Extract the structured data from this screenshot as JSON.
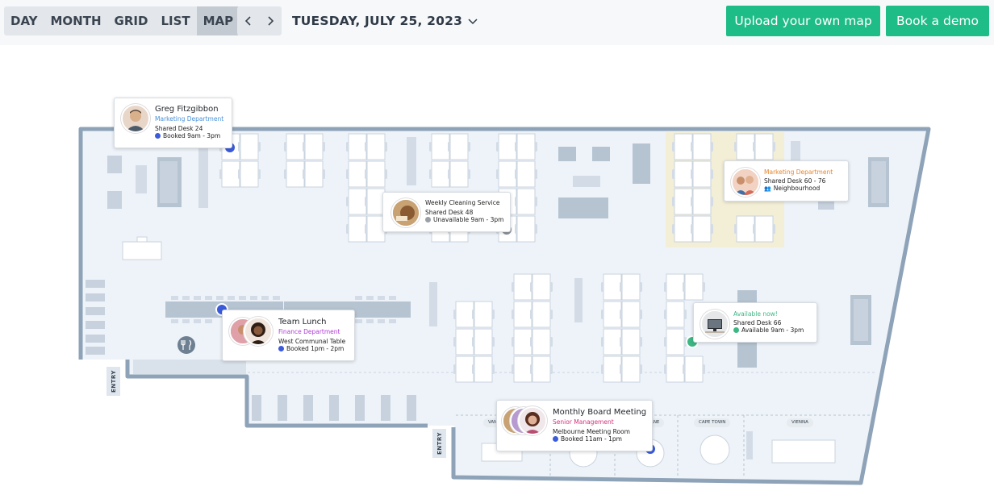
{
  "toolbar": {
    "view_tabs": [
      {
        "label": "DAY"
      },
      {
        "label": "MONTH"
      },
      {
        "label": "GRID"
      },
      {
        "label": "LIST"
      },
      {
        "label": "MAP",
        "active": true
      }
    ],
    "date_label": "TUESDAY, JULY 25, 2023",
    "upload_label": "Upload your own map",
    "demo_label": "Book a demo"
  },
  "colors": {
    "accent_green": "#1ebc87",
    "booked_blue": "#3b5bdb",
    "unavailable_gray": "#9aa0a6",
    "available_green": "#3cb784",
    "wall": "#8ea3b8",
    "floor": "#eef3f9",
    "neighbourhood": "#f4efd6"
  },
  "entries": [
    {
      "label": "ENTRY"
    },
    {
      "label": "ENTRY"
    }
  ],
  "rooms": [
    "VAN",
    "RNE",
    "CAPE TOWN",
    "VIENNA"
  ],
  "cards": {
    "greg": {
      "name": "Greg Fitzgibbon",
      "department": "Marketing Department",
      "desk": "Shared Desk 24",
      "status": "Booked 9am - 3pm"
    },
    "cleaning": {
      "name": "Weekly Cleaning Service",
      "desk": "Shared Desk 48",
      "status": "Unavailable 9am - 3pm"
    },
    "marketing": {
      "department": "Marketing Department",
      "desk": "Shared Desk 60 - 76",
      "status": "Neighbourhood"
    },
    "lunch": {
      "name": "Team Lunch",
      "department": "Finance Department",
      "desk": "West Communal Table",
      "status": "Booked 1pm - 2pm"
    },
    "available": {
      "heading": "Available now!",
      "desk": "Shared Desk 66",
      "status": "Available 9am - 3pm"
    },
    "board": {
      "name": "Monthly Board Meeting",
      "department": "Senior Management",
      "desk": "Melbourne Meeting Room",
      "status": "Booked 11am - 1pm"
    }
  }
}
